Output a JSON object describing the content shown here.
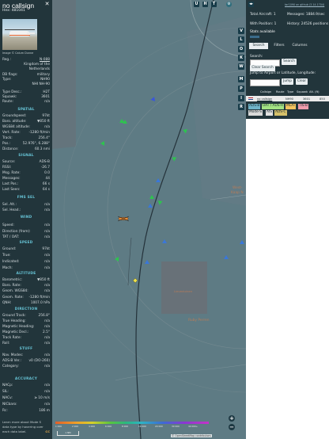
{
  "left": {
    "callsign": "no callsign",
    "hex": "Hex: 481041",
    "photo_credit": "Image © Calum Dunne",
    "reg_label": "Reg.:",
    "reg_value": "N-088",
    "country_line1": "Kingdom of the",
    "country_line2": "Netherlands",
    "db_flags_label": "DB flags:",
    "db_flags_value": "military",
    "type_label": "Type:",
    "type_value": "NH90",
    "type_full": "NHI NH-90",
    "type_desc_label": "Type Desc.:",
    "type_desc_value": "H2T",
    "squawk_label": "Squawk:",
    "squawk_value": "3601",
    "route_label": "Route:",
    "route_value": "n/a",
    "spatial_title": "SPATIAL",
    "spatial": [
      {
        "k": "Groundspeed:",
        "v": "97kt"
      },
      {
        "k": "Baro. altitude:",
        "v": "▼850 ft"
      },
      {
        "k": "WGS84 altitude:",
        "v": "n/a"
      },
      {
        "k": "Vert. Rate:",
        "v": "-1280 ft/min"
      },
      {
        "k": "Track:",
        "v": "256.4°"
      },
      {
        "k": "Pos.:",
        "v": "52.976°, 6.288°"
      },
      {
        "k": "Distance:",
        "v": "60.3 nmi"
      }
    ],
    "signal_title": "SIGNAL",
    "signal": [
      {
        "k": "Source:",
        "v": "ADS-B"
      },
      {
        "k": "RSSI:",
        "v": "-26.7"
      },
      {
        "k": "Msg. Rate:",
        "v": "0.0"
      },
      {
        "k": "Messages:",
        "v": "44"
      },
      {
        "k": "Last Pos.:",
        "v": "66 s"
      },
      {
        "k": "Last Seen:",
        "v": "64 s"
      }
    ],
    "fms_title": "FMS SEL",
    "fms": [
      {
        "k": "Sel. Alt.:",
        "v": "n/a"
      },
      {
        "k": "Sel. Head.:",
        "v": "n/a"
      }
    ],
    "wind_title": "WIND",
    "wind": [
      {
        "k": "Speed:",
        "v": "n/a"
      },
      {
        "k": "Direction (from):",
        "v": "n/a"
      },
      {
        "k": "TAT / OAT:",
        "v": "n/a"
      }
    ],
    "speed_title": "SPEED",
    "speed": [
      {
        "k": "Ground:",
        "v": "97kt"
      },
      {
        "k": "True:",
        "v": "n/a"
      },
      {
        "k": "Indicated:",
        "v": "n/a"
      },
      {
        "k": "Mach:",
        "v": "n/a"
      }
    ],
    "altitude_title": "ALTITUDE",
    "altitude": [
      {
        "k": "Barometric:",
        "v": "▼850 ft"
      },
      {
        "k": "Baro. Rate:",
        "v": "n/a"
      },
      {
        "k": "Geom. WGS84:",
        "v": "n/a"
      },
      {
        "k": "Geom. Rate:",
        "v": "-1280 ft/min"
      },
      {
        "k": "QNH:",
        "v": "1007.0 hPa"
      }
    ],
    "direction_title": "DIRECTION",
    "direction": [
      {
        "k": "Ground Track:",
        "v": "256.8°"
      },
      {
        "k": "True Heading:",
        "v": "n/a"
      },
      {
        "k": "Magnetic Heading:",
        "v": "n/a"
      },
      {
        "k": "Magnetic Decl.:",
        "v": "2.5°"
      },
      {
        "k": "Track Rate:",
        "v": "n/a"
      },
      {
        "k": "Roll:",
        "v": "n/a"
      }
    ],
    "stuff_title": "STUFF",
    "stuff": [
      {
        "k": "Nav. Modes:",
        "v": "n/a"
      },
      {
        "k": "ADS-B Ver.:",
        "v": "v0 (DO-260)"
      },
      {
        "k": "Category:",
        "v": "n/a"
      }
    ],
    "accuracy_title": "ACCURACY",
    "accuracy": [
      {
        "k": "NACp:",
        "v": "n/a"
      },
      {
        "k": "SIL:",
        "v": "n/a"
      },
      {
        "k": "NACv:",
        "v": "≥ 10 m/s"
      },
      {
        "k": "NICbaro:",
        "v": "n/a"
      },
      {
        "k": "Rc:",
        "v": "186 m"
      }
    ],
    "footer_line1": "Learn more about Mode S",
    "footer_line2": "data type by hovering over",
    "footer_line3": "each data label.",
    "footer_badge": "CC"
  },
  "map": {
    "top_buttons": [
      "U",
      "H",
      "T"
    ],
    "side_buttons": [
      "V",
      "L",
      "O",
      "K",
      "W",
      "M",
      "P",
      "I",
      "R"
    ],
    "labels": {
      "west": "West-",
      "west2": "Kaap N",
      "town_a": "Ruby Perren",
      "town_b": "Lieveduinen"
    },
    "legend_ticks": [
      "1 000",
      "2 000",
      "4 000",
      "6 000",
      "8 000",
      "10 000",
      "20 000",
      "30 000",
      "40 000+"
    ],
    "scale": "1 NM",
    "zoom_in": "+",
    "zoom_out": "−",
    "attribution": "© OpenStreetMap contributors",
    "colors": {
      "track": "#24323a",
      "aircraft_green": "#2ec34f",
      "aircraft_blue": "#3a77d9",
      "aircraft_yellow": "#f0e34a",
      "selected": "#e48c3a"
    }
  },
  "right": {
    "version_link": "tar1090 on github (3.14.1704)",
    "total_aircraft": "Total Aircraft: 1",
    "with_position": "With Position: 1",
    "stats_available": "Stats available",
    "messages": "Messages: 1884.9/sec",
    "history": "History: 24526 positions",
    "tabs": [
      "Search",
      "Filters",
      "Columns"
    ],
    "search_label": "Search:",
    "search_button": "Search",
    "clear_search": "Clear Search",
    "jump_label": "Jump to Airport or Latitude, Longitude:",
    "jump_button": "Jump",
    "clear_button": "Clear",
    "table_headers": [
      "Callsign",
      "Route",
      "Type",
      "Squawk",
      "Alt. (ft)"
    ],
    "table_rows": [
      {
        "flag": "nl",
        "callsign": "no callsign",
        "route": "",
        "type": "NH90",
        "squawk": "3601",
        "alt": "850"
      }
    ],
    "chips": [
      {
        "label": "ADS-B",
        "bg": "#6fb3c8"
      },
      {
        "label": "UAT / ADS-R",
        "bg": "#a3e283"
      },
      {
        "label": "MLAT",
        "bg": "#f3c35f"
      },
      {
        "label": "TIS-B",
        "bg": "#f09cac"
      },
      {
        "label": "Mode-S",
        "bg": "#d9d9d9"
      },
      {
        "label": "AIS",
        "bg": "#e2e2e2"
      },
      {
        "label": "ADS-C",
        "bg": "#d5c06a"
      }
    ]
  }
}
